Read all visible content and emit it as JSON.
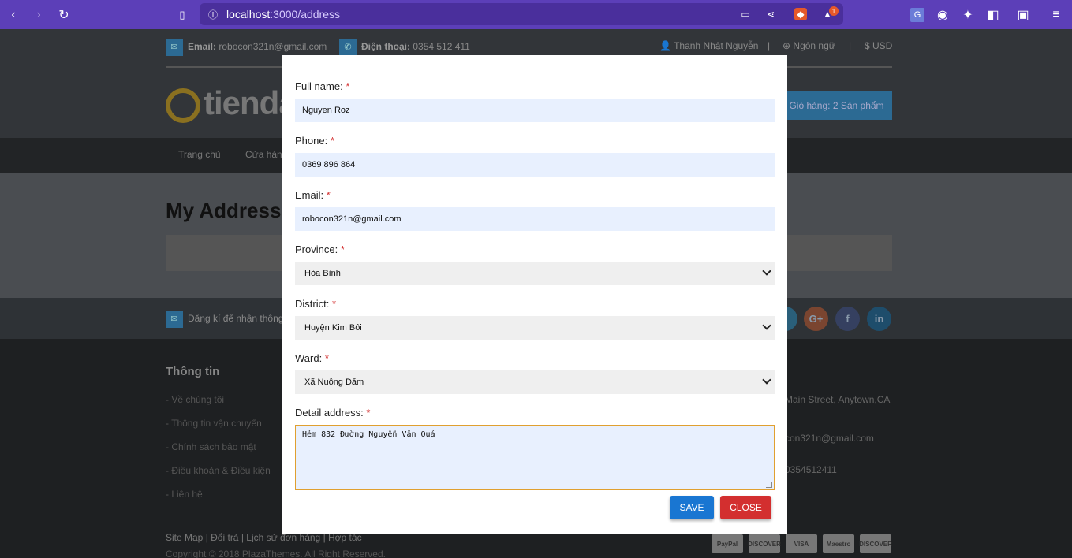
{
  "browser": {
    "url_host": "localhost",
    "url_path": ":3000/address",
    "badge_count": "1"
  },
  "topbar": {
    "email_label": "Email:",
    "email_value": "robocon321n@gmail.com",
    "phone_label": "Điện thoại:",
    "phone_value": "0354 512 411",
    "user_name": "Thanh Nhật Nguyễn",
    "language": "Ngôn ngữ",
    "currency": "$ USD"
  },
  "header": {
    "logo_text": "tienda",
    "cart_label": "Giỏ hàng: 2 Sản phẩm"
  },
  "menu": {
    "items": [
      "Trang chủ",
      "Cửa hàng"
    ]
  },
  "page": {
    "title": "My Addresses"
  },
  "newsletter": {
    "text": "Đăng kí để nhận thông"
  },
  "footer": {
    "info_title": "Thông tin",
    "links": [
      "- Về chúng tôi",
      "- Thông tin vận chuyển",
      "- Chính sách bảo mật",
      "- Điều khoản & Điều kiện",
      "- Liên hệ"
    ],
    "address_partial": "Main Street, Anytown,CA",
    "email_partial": "con321n@gmail.com",
    "phone_partial": "0354512411",
    "bottom_links": "Site Map | Đổi trả | Lịch sử đơn hàng | Hợp tác",
    "copyright": "Copyright © 2018 PlazaThemes. All Right Reserved.",
    "payments": [
      "PayPal",
      "DISCOVER",
      "VISA",
      "Maestro",
      "DISCOVER"
    ]
  },
  "form": {
    "full_name_label": "Full name:",
    "full_name_value": "Nguyen Roz",
    "phone_label": "Phone:",
    "phone_value": "0369 896 864",
    "email_label": "Email:",
    "email_value": "robocon321n@gmail.com",
    "province_label": "Province:",
    "province_value": "Hòa Bình",
    "district_label": "District:",
    "district_value": "Huyện Kim Bôi",
    "ward_label": "Ward:",
    "ward_value": "Xã Nuông Dăm",
    "detail_label": "Detail address:",
    "detail_value": "Hẻm 832 Đường Nguyễn Văn Quá",
    "required_mark": "*",
    "save_label": "SAVE",
    "close_label": "CLOSE"
  },
  "colors": {
    "browser_bar": "#5c3fb8",
    "save_button": "#1976d2",
    "close_button": "#d32f2f",
    "input_bg": "#e8f0fe"
  }
}
